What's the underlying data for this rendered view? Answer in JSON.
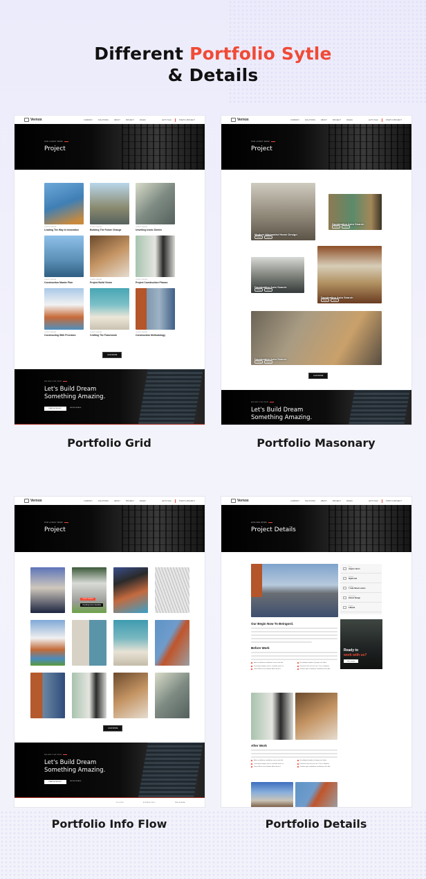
{
  "headline": {
    "part1": "Different",
    "accent": "Portfolio Sytle",
    "line2": "& Details"
  },
  "colors": {
    "accent": "#f04a36",
    "dark": "#111111",
    "background": "#efeffb"
  },
  "site": {
    "logo": "Vernox",
    "nav": [
      "COMPANY",
      "SOLUTIONS",
      "ABOUT",
      "PROJECT",
      "PAGES"
    ],
    "phone": "LET'S TALK",
    "cta": "START A PROJECT"
  },
  "cards": {
    "grid": {
      "label": "Portfolio Grid",
      "hero_kicker": "OUR LATEST WORK",
      "hero_title": "Project",
      "items": [
        {
          "cat": "CLIENT: DESIGN",
          "name": "Leading The Way In Innovation"
        },
        {
          "cat": "CLIENT: DESIGN",
          "name": "Building The Future Change"
        },
        {
          "cat": "CLIENT: DESIGN",
          "name": "Unveiling Iconic Denies"
        },
        {
          "cat": "CLIENT: DESIGN",
          "name": "Construction Master Plan"
        },
        {
          "cat": "CLIENT: DESIGN",
          "name": "Project Build Vision"
        },
        {
          "cat": "CLIENT: DESIGN",
          "name": "Project Construction Phases"
        },
        {
          "cat": "CLIENT: DESIGN",
          "name": "Constructing With Precision"
        },
        {
          "cat": "CLIENT: DESIGN",
          "name": "Crafting The Framework"
        },
        {
          "cat": "CLIENT: DESIGN",
          "name": "Construction Methodology"
        }
      ],
      "load_more": "LOAD MORE"
    },
    "masonry": {
      "label": "Portfolio Masonary",
      "hero_kicker": "OUR LATEST WORK",
      "hero_title": "Project",
      "items": [
        {
          "name": "Modern Minimalist Home Design"
        },
        {
          "name": "Dominating Auto Search"
        },
        {
          "name": "Dominating Auto Search"
        },
        {
          "name": "Dominating Auto Search"
        },
        {
          "name": "Dominating Auto Search"
        }
      ],
      "pills": [
        "Building",
        "Interior"
      ],
      "load_more": "LOAD MORE"
    },
    "infoflow": {
      "label": "Portfolio Info Flow",
      "hero_kicker": "OUR LATEST WORK",
      "hero_title": "Project",
      "hover_tag": "CLIENT: DESIGN",
      "hover_name": "Unveiling Iconic Identities",
      "load_more": "LOAD MORE",
      "footer": [
        "SOLUTION",
        "BUSINESS FIELD",
        "TAKE A BREAK"
      ]
    },
    "details": {
      "label": "Portfolio Details",
      "hero_kicker": "EXPLORE MORE",
      "hero_title": "Project Details",
      "info": [
        {
          "k": "Client",
          "v": "Anguso Jason"
        },
        {
          "k": "Category",
          "v": "Sigma Lab"
        },
        {
          "k": "Location",
          "v": "7 Lake Street London"
        },
        {
          "k": "Project Type",
          "v": "Interior Design"
        },
        {
          "k": "Duration",
          "v": "3 Month"
        }
      ],
      "ready_line1": "Ready to",
      "ready_line2": "work with us?",
      "quote": "Get a quote",
      "section1": "Our Begin Now To Beingord.",
      "section2": "Before Work",
      "section3": "After Work",
      "bullets": [
        "Aulte vestibulum vestibulum varius aute like.",
        "Ex millimple dapibus Quisque nisl ullam.",
        "Consequat magna auer te convallis purus ut.",
        "Phaselus vitae ant nisl cas. Cras in aliquam.",
        "Vitae efficitur risus lobortis libero bessel.",
        "Porttitor aget vestibulum vestibulum nisl nulla."
      ]
    }
  },
  "cta": {
    "kicker": "BUILDING YOUR VISION",
    "line1": "Let's Build Dream",
    "line2": "Something Amazing.",
    "primary": "START A PROJECT",
    "secondary": "KNOW DETAILS"
  }
}
